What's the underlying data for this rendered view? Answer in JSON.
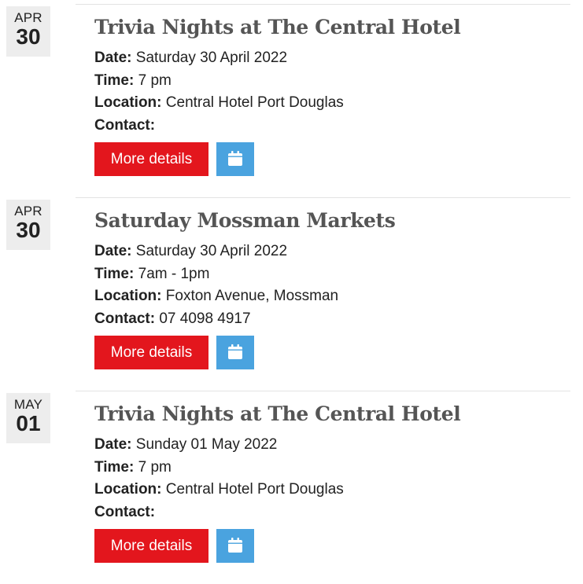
{
  "events": [
    {
      "month": "APR",
      "day": "30",
      "title": "Trivia Nights at The Central Hotel",
      "date_label": "Date:",
      "date": "Saturday 30 April 2022",
      "time_label": "Time:",
      "time": "7 pm",
      "location_label": "Location:",
      "location": "Central Hotel Port Douglas",
      "contact_label": "Contact:",
      "contact": "",
      "more_label": "More details",
      "calendar_icon": "calendar-icon"
    },
    {
      "month": "APR",
      "day": "30",
      "title": "Saturday Mossman Markets",
      "date_label": "Date:",
      "date": "Saturday 30 April 2022",
      "time_label": "Time:",
      "time": "7am - 1pm",
      "location_label": "Location:",
      "location": "Foxton Avenue, Mossman",
      "contact_label": "Contact:",
      "contact": "07 4098 4917",
      "more_label": "More details",
      "calendar_icon": "calendar-icon"
    },
    {
      "month": "MAY",
      "day": "01",
      "title": "Trivia Nights at The Central Hotel",
      "date_label": "Date:",
      "date": "Sunday 01 May 2022",
      "time_label": "Time:",
      "time": "7 pm",
      "location_label": "Location:",
      "location": "Central Hotel Port Douglas",
      "contact_label": "Contact:",
      "contact": "",
      "more_label": "More details",
      "calendar_icon": "calendar-icon"
    }
  ],
  "colors": {
    "more_button": "#e3161d",
    "calendar_button": "#4aa3df",
    "title": "#555555",
    "date_badge": "#ededed"
  }
}
